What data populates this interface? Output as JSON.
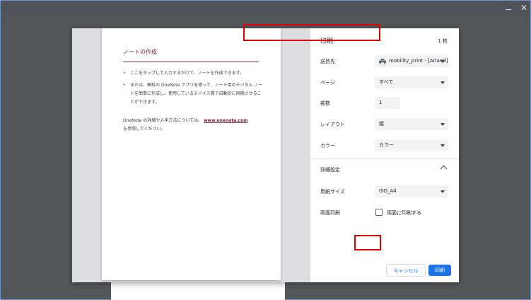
{
  "window": {
    "close_glyph": "✕"
  },
  "preview": {
    "title": "ノートの作成",
    "bullets": [
      "ここをタップして入力するだけで、ノートを作成できます。",
      "または、無料の OneNote アプリを使って、ノート用のデジタル ノートを簡単に作成し、使用しているデバイス間で自動的に同期させることができます。"
    ],
    "para_before": "OneNote の詳細や入手方法については、",
    "link": "www.onenote.com",
    "para_after": "を参照してください。"
  },
  "settings": {
    "title": "印刷",
    "count": "1 枚",
    "destination": {
      "label": "送信先",
      "value": "mobility_print - [Arland]"
    },
    "pages": {
      "label": "ページ",
      "value": "すべて"
    },
    "copies": {
      "label": "部数",
      "value": "1"
    },
    "layout": {
      "label": "レイアウト",
      "value": "縦"
    },
    "color": {
      "label": "カラー",
      "value": "カラー"
    },
    "advanced": {
      "label": "詳細設定"
    },
    "paper": {
      "label": "用紙サイズ",
      "value": "ISO_A4"
    },
    "duplex": {
      "label": "両面印刷",
      "option": "両面に印刷する",
      "checked": false
    },
    "cancel_label": "キャンセル",
    "print_label": "印刷"
  },
  "colors": {
    "accent": "#1a73e8",
    "highlight": "#e00000",
    "heading": "#7a2138"
  }
}
